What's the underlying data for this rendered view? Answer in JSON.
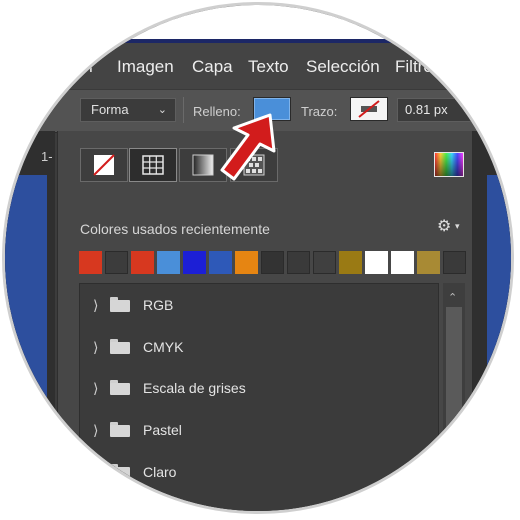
{
  "menu": {
    "items": [
      {
        "label": "Imagen"
      },
      {
        "label": "Capa"
      },
      {
        "label": "Texto"
      },
      {
        "label": "Selección"
      },
      {
        "label": "Filtro"
      }
    ]
  },
  "options_bar": {
    "mode_select_value": "Forma",
    "fill_label": "Relleno:",
    "fill_color": "#4a8fd9",
    "stroke_label": "Trazo:",
    "stroke_value": "none",
    "stroke_width": "0.81 px"
  },
  "document": {
    "tab_label": "1-"
  },
  "fill_panel": {
    "type_buttons": [
      {
        "icon": "no-color-icon"
      },
      {
        "icon": "solid-color-grid-icon",
        "active": true
      },
      {
        "icon": "gradient-icon"
      },
      {
        "icon": "pattern-icon"
      }
    ],
    "picker_icon": "color-picker-icon",
    "recent_label": "Colores usados recientemente",
    "settings_icon": "gear-icon",
    "recent_colors": [
      "#d7381f",
      "#3c3c3c",
      "#d7381f",
      "#4a8fd9",
      "#1c1fd6",
      "#2e59b8",
      "#e68512",
      "#333333",
      "#3a3a3a",
      "#404040",
      "#9a7a14",
      "#ffffff",
      "#ffffff",
      "#a88a34",
      "#3a3a3a"
    ],
    "folders": [
      {
        "label": "RGB"
      },
      {
        "label": "CMYK"
      },
      {
        "label": "Escala de grises"
      },
      {
        "label": "Pastel"
      },
      {
        "label": "Claro"
      }
    ]
  },
  "annotation": {
    "arrow_color": "#d21c1c"
  }
}
